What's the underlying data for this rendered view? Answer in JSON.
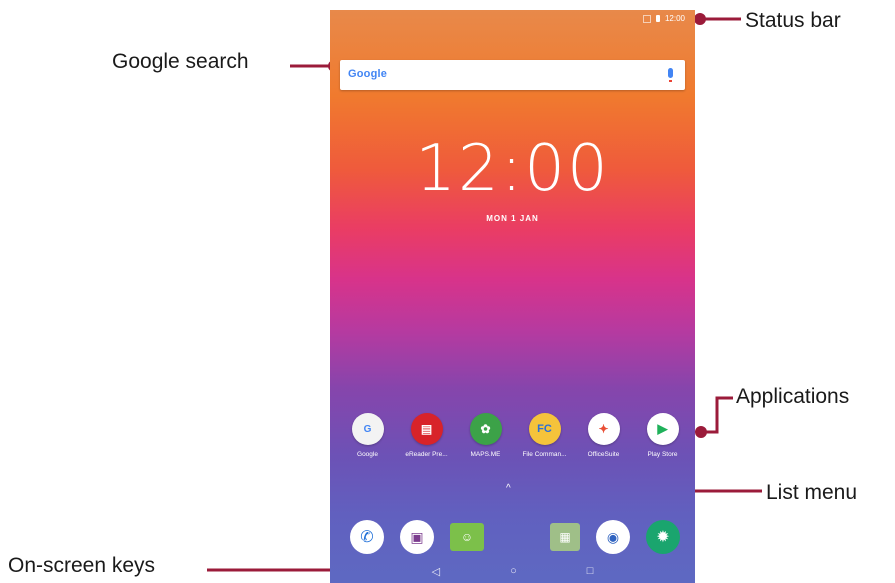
{
  "callouts": {
    "status_bar": "Status bar",
    "google_search": "Google search",
    "applications": "Applications",
    "list_menu": "List menu",
    "onscreen_keys": "On-screen keys"
  },
  "status": {
    "time": "12:00"
  },
  "search": {
    "logo": "Google"
  },
  "lock": {
    "time": "12:00",
    "date": "MON 1 JAN"
  },
  "apps": [
    {
      "label": "Google",
      "glyph": "G"
    },
    {
      "label": "eReader Pre...",
      "glyph": "▤"
    },
    {
      "label": "MAPS.ME",
      "glyph": "✿"
    },
    {
      "label": "File Comman...",
      "glyph": "FC"
    },
    {
      "label": "OfficeSuite",
      "glyph": "✦"
    },
    {
      "label": "Play Store",
      "glyph": "▶"
    }
  ],
  "list_menu_glyph": "^",
  "dock": {
    "phone": "✆",
    "gallery": "▣",
    "messages": "☺",
    "files": "▦",
    "camera": "◉",
    "settings": "✹"
  },
  "navkeys": {
    "back": "◁",
    "home": "○",
    "recents": "□"
  },
  "colors": {
    "callout_line": "#9b1b3a"
  }
}
